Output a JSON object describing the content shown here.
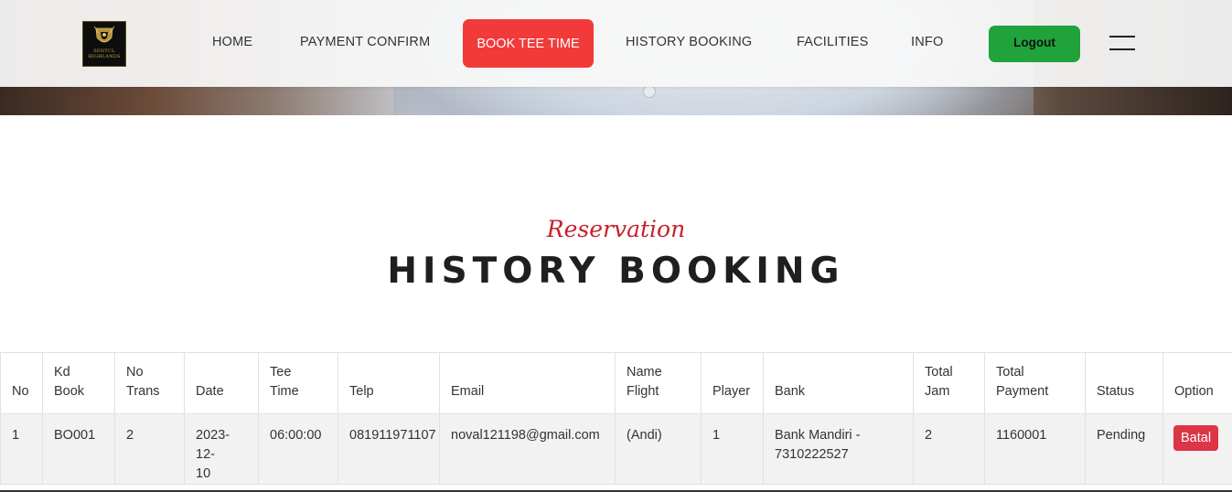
{
  "header": {
    "logo_text_line1": "SENTUL",
    "logo_text_line2": "HIGHLANDS",
    "nav": {
      "home": "HOME",
      "payment_confirm": "PAYMENT CONFIRM",
      "book_tee_time": "BOOK TEE TIME",
      "history_booking": "HISTORY BOOKING",
      "facilities": "FACILITIES",
      "info": "INFO"
    },
    "logout_label": "Logout",
    "accent_color": "#f23a3a",
    "logout_color": "#20a33a",
    "menu_icon": "hamburger-icon"
  },
  "section": {
    "subtitle": "Reservation",
    "title": "HISTORY BOOKING"
  },
  "table": {
    "headers": [
      [
        "No"
      ],
      [
        "Kd",
        "Book"
      ],
      [
        "No",
        "Trans"
      ],
      [
        "Date"
      ],
      [
        "Tee",
        "Time"
      ],
      [
        "Telp"
      ],
      [
        "Email"
      ],
      [
        "Name",
        "Flight"
      ],
      [
        "Player"
      ],
      [
        "Bank"
      ],
      [
        "Total",
        "Jam"
      ],
      [
        "Total",
        "Payment"
      ],
      [
        "Status"
      ],
      [
        "Option"
      ]
    ],
    "rows": [
      {
        "no": "1",
        "kd_book": "BO001",
        "no_trans": "2",
        "date_line1": "2023-12-",
        "date_line2": "10",
        "tee_time": "06:00:00",
        "telp": "081911971107",
        "email": "noval121198@gmail.com",
        "name_flight": "(Andi)",
        "player": "1",
        "bank_line1": "Bank Mandiri -",
        "bank_line2": "7310222527",
        "total_jam": "2",
        "total_payment": "1160001",
        "status": "Pending",
        "option_label": "Batal"
      }
    ],
    "batal_color": "#dc3545"
  }
}
